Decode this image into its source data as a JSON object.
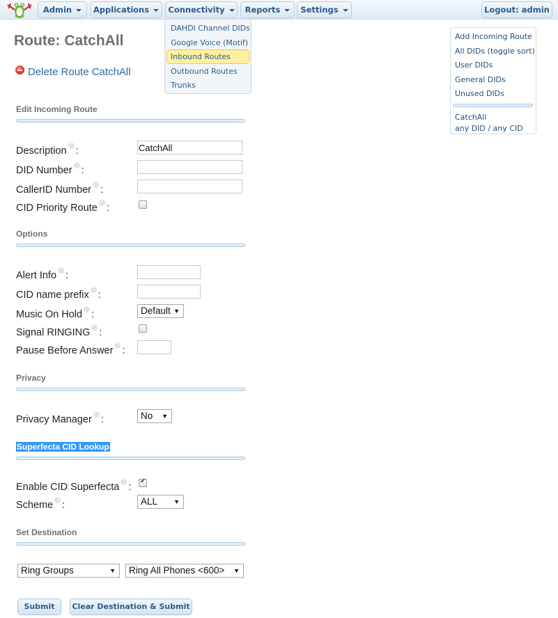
{
  "nav": {
    "menus": [
      {
        "label": "Admin"
      },
      {
        "label": "Applications"
      },
      {
        "label": "Connectivity"
      },
      {
        "label": "Reports"
      },
      {
        "label": "Settings"
      }
    ],
    "logout_label": "Logout: admin",
    "connectivity_dropdown": [
      {
        "label": "DAHDI Channel DIDs",
        "active": false
      },
      {
        "label": "Google Voice (Motif)",
        "active": false
      },
      {
        "label": "Inbound Routes",
        "active": true
      },
      {
        "label": "Outbound Routes",
        "active": false
      },
      {
        "label": "Trunks",
        "active": false
      }
    ]
  },
  "sidebar": {
    "items": [
      {
        "label": "Add Incoming Route"
      },
      {
        "label": "All DIDs (toggle sort)"
      },
      {
        "label": "User DIDs"
      },
      {
        "label": "General DIDs"
      },
      {
        "label": "Unused DIDs"
      }
    ],
    "routes": [
      {
        "name": "CatchAll",
        "detail": "any DID / any CID"
      }
    ]
  },
  "page": {
    "title": "Route: CatchAll",
    "delete_label": "Delete Route CatchAll"
  },
  "sections": {
    "edit": {
      "heading": "Edit Incoming Route",
      "description": {
        "label": "Description",
        "value": "CatchAll"
      },
      "did_number": {
        "label": "DID Number",
        "value": ""
      },
      "callerid_number": {
        "label": "CallerID Number",
        "value": ""
      },
      "cid_priority": {
        "label": "CID Priority Route",
        "checked": false
      }
    },
    "options": {
      "heading": "Options",
      "alert_info": {
        "label": "Alert Info",
        "value": ""
      },
      "cid_name_prefix": {
        "label": "CID name prefix",
        "value": ""
      },
      "music_on_hold": {
        "label": "Music On Hold",
        "selected": "Default"
      },
      "signal_ringing": {
        "label": "Signal RINGING",
        "checked": false
      },
      "pause_before_answer": {
        "label": "Pause Before Answer",
        "value": ""
      }
    },
    "privacy": {
      "heading": "Privacy",
      "privacy_manager": {
        "label": "Privacy Manager",
        "selected": "No"
      }
    },
    "superfecta": {
      "heading": "Superfecta CID Lookup",
      "enable": {
        "label": "Enable CID Superfecta",
        "checked": true
      },
      "scheme": {
        "label": "Scheme",
        "selected": "ALL"
      }
    },
    "destination": {
      "heading": "Set Destination",
      "type_selected": "Ring Groups",
      "target_selected": "Ring All Phones <600>"
    }
  },
  "buttons": {
    "submit": "Submit",
    "clear_submit": "Clear Destination & Submit"
  },
  "colon": ":",
  "arrow": "▼"
}
